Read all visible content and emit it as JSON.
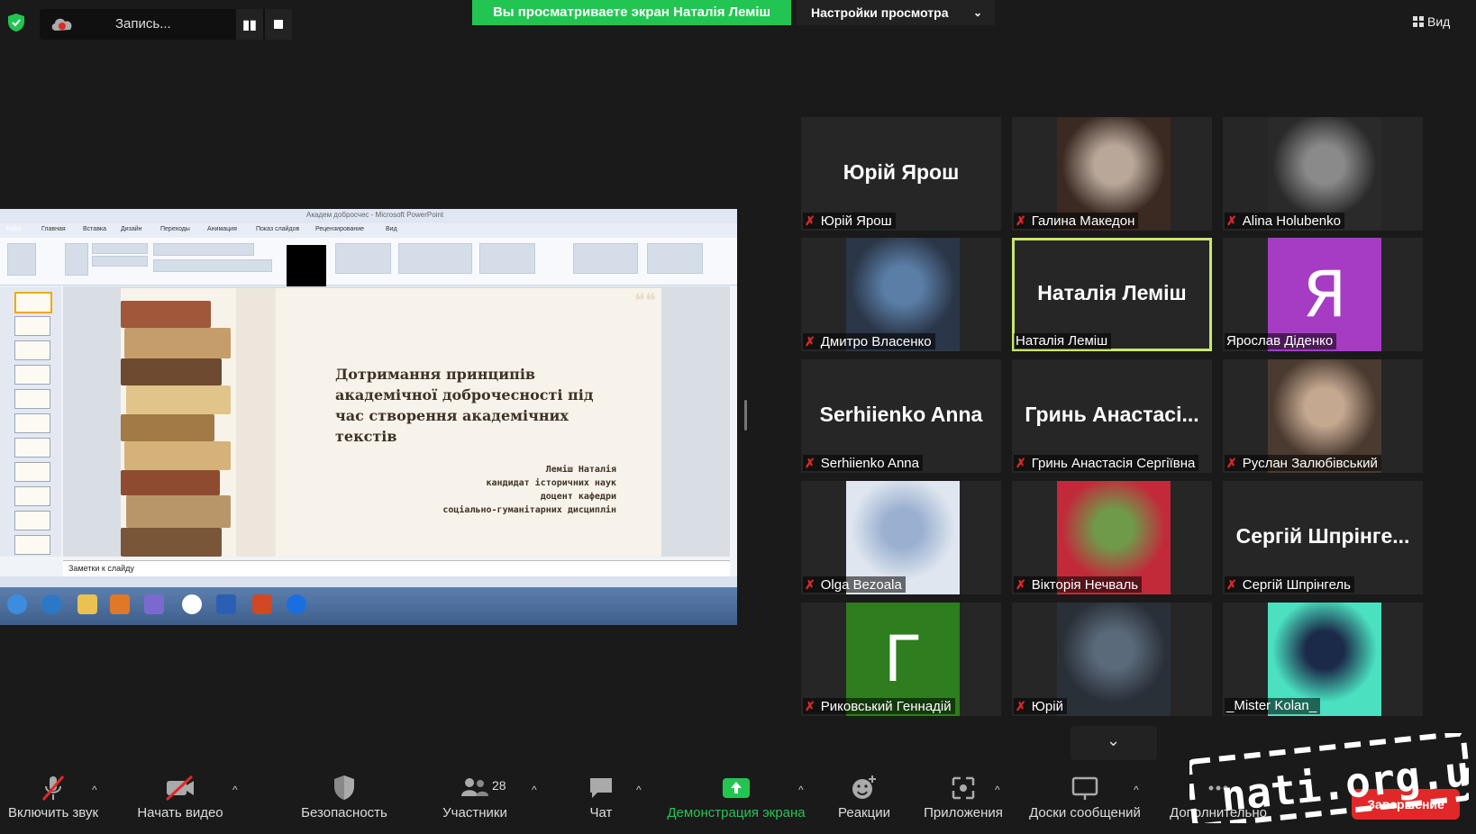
{
  "topbar": {
    "recording_label": "Запись...",
    "pause_glyph": "▮▮",
    "viewing_banner": "Вы просматриваете экран Наталія Леміш",
    "view_settings": "Настройки просмотра",
    "view_settings_chevron": "⌄",
    "view_button": "Вид",
    "view_icon": "grid-icon"
  },
  "shared_screen": {
    "window_title": "Академ добросчес - Microsoft PowerPoint",
    "ribbon_tabs": [
      "Файл",
      "Главная",
      "Вставка",
      "Дизайн",
      "Переходы",
      "Анимация",
      "Показ слайдов",
      "Рецензирование",
      "Вид"
    ],
    "slide_title": "Дотримання принципів академічної доброчесності під час створення академічних текстів",
    "slide_author_lines": [
      "Леміш Наталія",
      "кандидат історичних наук",
      "доцент кафедри",
      "соціально-гуманітарних дисциплін"
    ],
    "notes_placeholder": "Заметки к слайду",
    "slide_count": 11,
    "quote_glyph": "❝❝"
  },
  "participants": [
    {
      "name": "Юрій Ярош",
      "big_name": "Юрій Ярош",
      "muted": true,
      "type": "name"
    },
    {
      "name": "Галина Македон",
      "muted": true,
      "type": "photo"
    },
    {
      "name": "Alina Holubenko",
      "muted": true,
      "type": "photo"
    },
    {
      "name": "Дмитро Власенко",
      "muted": true,
      "type": "photo"
    },
    {
      "name": "Наталія Леміш",
      "big_name": "Наталія Леміш",
      "muted": false,
      "type": "name",
      "active": true
    },
    {
      "name": "Ярослав Діденко",
      "letter": "Я",
      "muted": false,
      "type": "letter",
      "color": "#a63cc4"
    },
    {
      "name": "Serhiienko Anna",
      "big_name": "Serhiienko Anna",
      "muted": true,
      "type": "name"
    },
    {
      "name": "Гринь Анастасія Сергіївна",
      "big_name": "Гринь  Анастасі...",
      "muted": true,
      "type": "name"
    },
    {
      "name": "Руслан Залюбівський",
      "muted": true,
      "type": "photo"
    },
    {
      "name": "Olga Bezoala",
      "muted": true,
      "type": "photo"
    },
    {
      "name": "Вікторія Нечваль",
      "muted": true,
      "type": "photo"
    },
    {
      "name": "Сергій Шпрінгель",
      "big_name": "Сергій  Шпрінге...",
      "muted": true,
      "type": "name"
    },
    {
      "name": "Риковський Геннадій",
      "letter": "Г",
      "muted": true,
      "type": "letter",
      "color": "#2e7d1e"
    },
    {
      "name": "Юрій",
      "muted": true,
      "type": "photo"
    },
    {
      "name": "_Mister Kolan_",
      "muted": false,
      "type": "photo"
    }
  ],
  "mic_glyph": "✗",
  "next_page_glyph": "⌄",
  "toolbar": {
    "unmute": "Включить звук",
    "start_video": "Начать видео",
    "security": "Безопасность",
    "participants": "Участники",
    "participants_count": "28",
    "chat": "Чат",
    "share_screen": "Демонстрация экрана",
    "reactions": "Реакции",
    "apps": "Приложения",
    "whiteboards": "Доски сообщений",
    "more": "Дополнительно",
    "end": "Завершение",
    "caret_glyph": "^"
  },
  "watermark": "nati.org.ua",
  "colors": {
    "accent_green": "#23c552",
    "active_speaker": "#c8e86a",
    "muted_red": "#e02828"
  }
}
